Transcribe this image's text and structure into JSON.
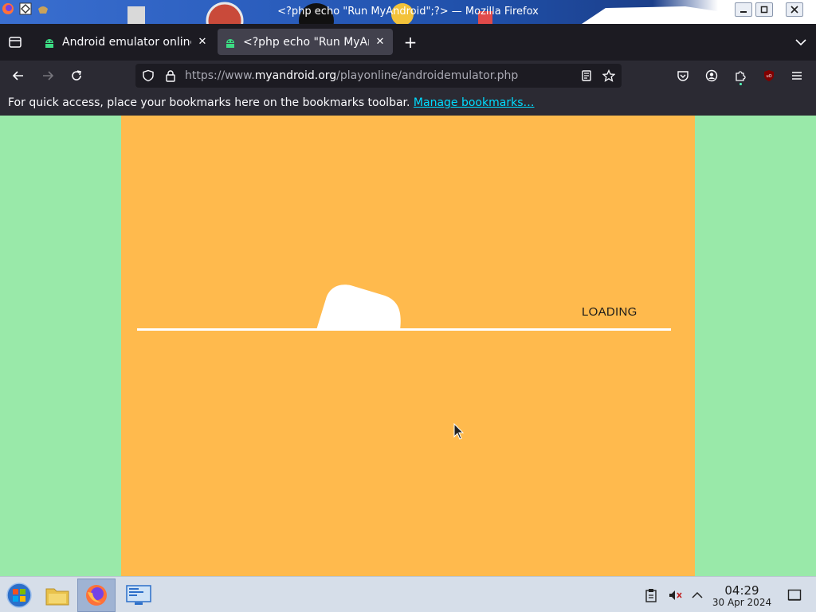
{
  "window": {
    "title": "<?php echo \"Run MyAndroid\";?> — Mozilla Firefox",
    "minimize_icon": "minimize-icon",
    "maximize_icon": "maximize-icon",
    "close_icon": "close-icon"
  },
  "tabs": [
    {
      "label": "Android emulator online",
      "active": false,
      "favicon": "android-icon"
    },
    {
      "label": "<?php echo \"Run MyAnd",
      "active": true,
      "favicon": "android-icon"
    }
  ],
  "tab_close_glyph": "✕",
  "new_tab_glyph": "+",
  "navbar": {
    "url_prefix": "https://www.",
    "url_host": "myandroid.org",
    "url_path": "/playonline/androidemulator.php"
  },
  "bookmarks": {
    "message": "For quick access, place your bookmarks here on the bookmarks toolbar.",
    "manage_link": "Manage bookmarks…"
  },
  "content": {
    "loading_text": "LOADING",
    "emulator_bg": "#ffba4d",
    "page_bg": "#99e9a9"
  },
  "taskbar": {
    "time": "04:29",
    "date": "30 Apr 2024"
  }
}
